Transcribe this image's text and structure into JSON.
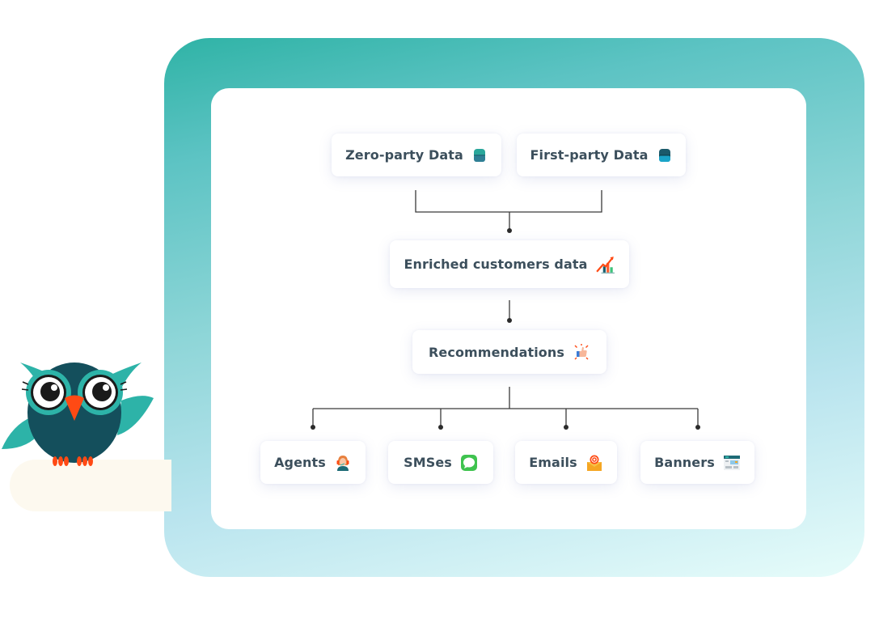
{
  "diagram": {
    "sources": [
      {
        "label": "Zero-party Data",
        "icon": "database-icon",
        "color": "#2a9d8f"
      },
      {
        "label": "First-party Data",
        "icon": "database-icon",
        "color": "#1a8fb0"
      }
    ],
    "enriched": {
      "label": "Enriched customers data",
      "icon": "growth-chart-icon"
    },
    "recommendations": {
      "label": "Recommendations",
      "icon": "thumbs-up-icon"
    },
    "channels": [
      {
        "label": "Agents",
        "icon": "support-agent-icon"
      },
      {
        "label": "SMSes",
        "icon": "chat-bubble-icon"
      },
      {
        "label": "Emails",
        "icon": "email-icon"
      },
      {
        "label": "Banners",
        "icon": "banner-icon"
      }
    ],
    "edges": [
      [
        "Zero-party Data",
        "Enriched customers data"
      ],
      [
        "First-party Data",
        "Enriched customers data"
      ],
      [
        "Enriched customers data",
        "Recommendations"
      ],
      [
        "Recommendations",
        "Agents"
      ],
      [
        "Recommendations",
        "SMSes"
      ],
      [
        "Recommendations",
        "Emails"
      ],
      [
        "Recommendations",
        "Banners"
      ]
    ]
  },
  "colors": {
    "panel_gradient_start": "#2fb3a6",
    "panel_gradient_end": "#e6fcfa",
    "text": "#3c4f5c",
    "connector": "#3a3a3a",
    "owl_body": "#144f5c",
    "owl_accent": "#2db3a8",
    "owl_beak": "#ff4a14"
  }
}
